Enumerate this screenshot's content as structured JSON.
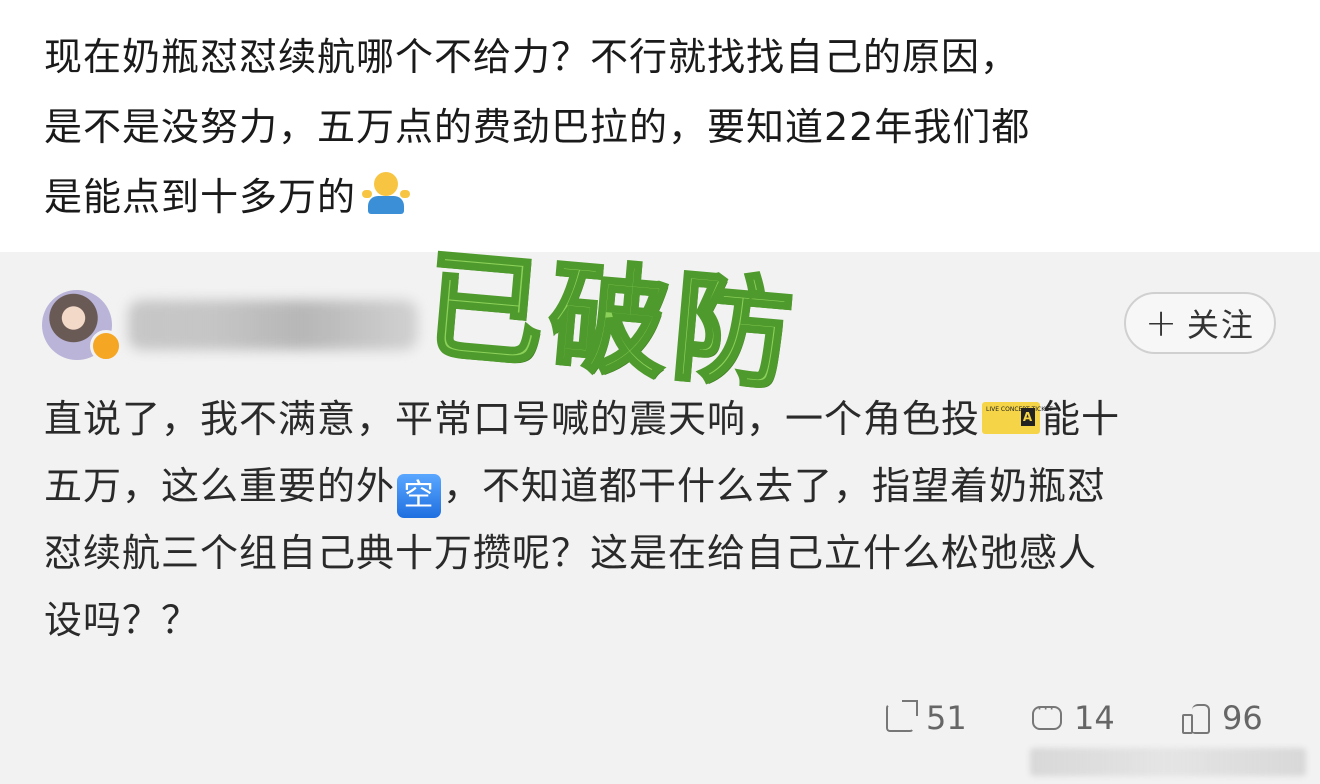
{
  "top_post": {
    "line1": "现在奶瓶怼怼续航哪个不给力？不行就找找自己的原因，",
    "line2": "是不是没努力，五万点的费劲巴拉的，要知道22年我们都",
    "line3": "是能点到十多万的",
    "emoji_icon": "person-shrugging-icon"
  },
  "repost": {
    "avatar_icon": "avatar",
    "follow_button": {
      "plus": "+",
      "label": "关注"
    },
    "stamp_text": "已破防",
    "line1_a": "直说了，我不满意，平常口号喊的震天响，一个角色投",
    "ticket_icon": "concert-ticket-icon",
    "ticket_small": "LIVE CONCERT TICKET",
    "ticket_zone": "A",
    "line1_b": "能十",
    "line2_a": "五万，这么重要的外",
    "kong_char": "空",
    "line2_b": "，不知道都干什么去了，指望着奶瓶怼",
    "line3": "怼续航三个组自己典十万攒呢？这是在给自己立什么松弛感人",
    "line4": "设吗？？"
  },
  "actions": {
    "share_count": "51",
    "comment_count": "14",
    "like_count": "96"
  },
  "colors": {
    "repost_bg": "#f2f2f2",
    "stamp_fill": "#8bd15a",
    "stamp_stroke": "#4f9a2c"
  }
}
